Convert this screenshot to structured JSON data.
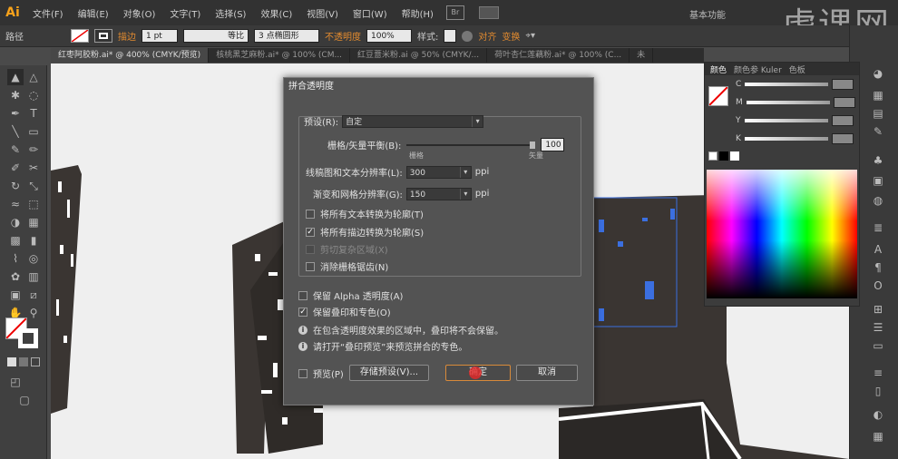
{
  "app": {
    "logo": "Ai",
    "workspace": "基本功能",
    "watermark": "虎课网"
  },
  "menu": [
    "文件(F)",
    "编辑(E)",
    "对象(O)",
    "文字(T)",
    "选择(S)",
    "效果(C)",
    "视图(V)",
    "窗口(W)",
    "帮助(H)"
  ],
  "bridge": "Br",
  "options": {
    "path_label": "路径",
    "stroke_label": "描边",
    "stroke_weight": "1 pt",
    "profile": "等比",
    "brush": "3 点椭圆形",
    "opacity_label": "不透明度",
    "opacity_value": "100%",
    "style_label": "样式:",
    "align_label": "对齐",
    "transform_label": "变换"
  },
  "tabs": [
    {
      "label": "红枣阿胶粉.ai* @ 400% (CMYK/预览)",
      "active": true
    },
    {
      "label": "核桃黑芝麻粉.ai* @ 100% (CM...",
      "active": false
    },
    {
      "label": "红豆薏米粉.ai @ 50% (CMYK/...",
      "active": false
    },
    {
      "label": "荷叶杏仁莲藕粉.ai* @ 100% (C...",
      "active": false
    },
    {
      "label": "未",
      "active": false
    }
  ],
  "color_panel": {
    "tabs": [
      "颜色",
      "颜色参 Kuler",
      "色板"
    ],
    "channels": [
      "C",
      "M",
      "Y",
      "K"
    ]
  },
  "dialog": {
    "title": "拼合透明度",
    "preset_label": "预设(R):",
    "preset_value": "自定",
    "raster_vector_label": "栅格/矢量平衡(B):",
    "raster_vector_value": "100",
    "raster_min_label": "栅格",
    "raster_max_label": "矢量",
    "line_art_label": "线稿图和文本分辨率(L):",
    "line_art_value": "300",
    "gradient_mesh_label": "渐变和网格分辨率(G):",
    "gradient_mesh_value": "150",
    "ppi": "ppi",
    "cb_text_outlines": {
      "label": "将所有文本转换为轮廓(T)",
      "checked": false
    },
    "cb_stroke_outlines": {
      "label": "将所有描边转换为轮廓(S)",
      "checked": true
    },
    "cb_clip_complex": {
      "label": "剪切复杂区域(X)",
      "checked": false
    },
    "cb_antialias": {
      "label": "消除栅格锯齿(N)",
      "checked": false
    },
    "cb_alpha": {
      "label": "保留 Alpha 透明度(A)",
      "checked": false
    },
    "cb_overprint": {
      "label": "保留叠印和专色(O)",
      "checked": true
    },
    "info1": "在包含透明度效果的区域中，叠印将不会保留。",
    "info2": "请打开“叠印预览”来预览拼合的专色。",
    "preview_label": "预览(P)",
    "save_preset_label": "存储预设(V)...",
    "ok_label": "确定",
    "cancel_label": "取消"
  }
}
